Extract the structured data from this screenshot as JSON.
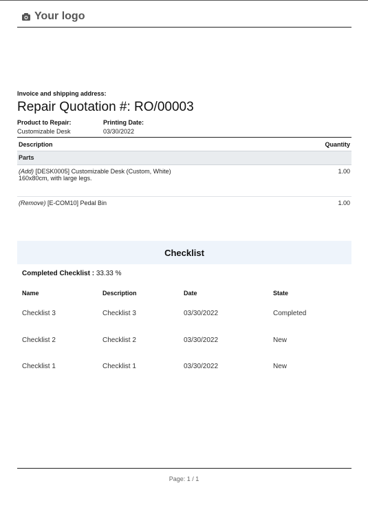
{
  "header": {
    "logo_text": "Your logo",
    "logo_icon": "camera-icon"
  },
  "document": {
    "address_label": "Invoice and shipping address:",
    "title": "Repair Quotation #: RO/00003",
    "product_label": "Product to Repair:",
    "product_value": "Customizable Desk",
    "printing_date_label": "Printing Date:",
    "printing_date_value": "03/30/2022"
  },
  "parts_table": {
    "col_description": "Description",
    "col_quantity": "Quantity",
    "section_label": "Parts",
    "lines": [
      {
        "operation": "(Add)",
        "description": "[DESK0005] Customizable Desk (Custom, White)",
        "description_line2": "160x80cm, with large legs.",
        "quantity": "1.00"
      },
      {
        "operation": "(Remove)",
        "description": "[E-COM10] Pedal Bin",
        "description_line2": "",
        "quantity": "1.00"
      }
    ]
  },
  "checklist": {
    "title": "Checklist",
    "completed_label": "Completed Checklist :",
    "completed_value": "33.33 %",
    "headers": [
      "Name",
      "Description",
      "Date",
      "State"
    ],
    "rows": [
      {
        "name": "Checklist 3",
        "description": "Checklist 3",
        "date": "03/30/2022",
        "state": "Completed"
      },
      {
        "name": "Checklist 2",
        "description": "Checklist 2",
        "date": "03/30/2022",
        "state": "New"
      },
      {
        "name": "Checklist 1",
        "description": "Checklist 1",
        "date": "03/30/2022",
        "state": "New"
      }
    ]
  },
  "footer": {
    "page_label": "Page: 1 / 1"
  },
  "colors": {
    "checklist_bar_bg": "#eef4fb",
    "section_bg": "#e9ecef"
  }
}
